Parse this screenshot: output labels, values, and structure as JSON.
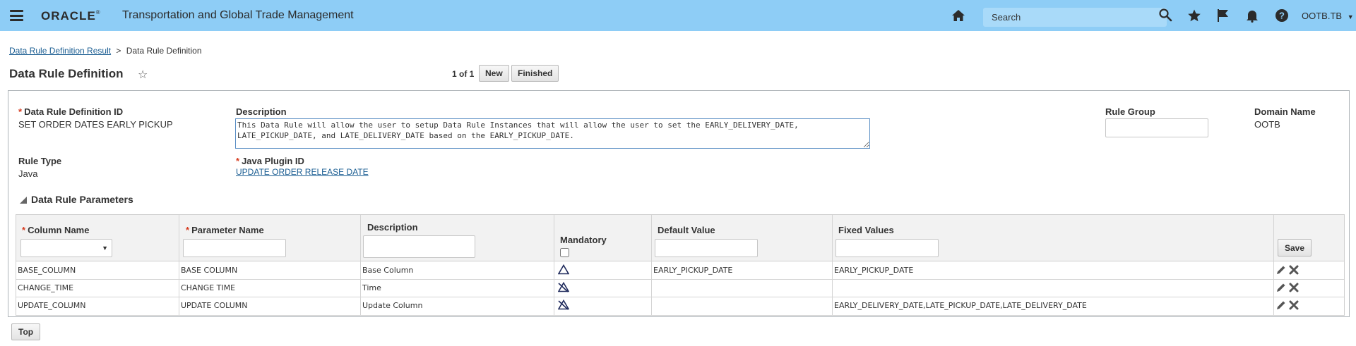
{
  "header": {
    "brand": "ORACLE",
    "app_title": "Transportation and Global Trade Management",
    "search_placeholder": "Search",
    "user": "OOTB.TB"
  },
  "breadcrumb": {
    "parent": "Data Rule Definition Result",
    "separator": ">",
    "current": "Data Rule Definition"
  },
  "page": {
    "title": "Data Rule Definition",
    "pager": "1 of 1",
    "new_label": "New",
    "finished_label": "Finished"
  },
  "form": {
    "id_label": "Data Rule Definition ID",
    "id_value": "SET ORDER DATES EARLY PICKUP",
    "description_label": "Description",
    "description_value": "This Data Rule will allow the user to setup Data Rule Instances that will allow the user to set the EARLY_DELIVERY_DATE, LATE_PICKUP_DATE, and LATE_DELIVERY_DATE based on the EARLY_PICKUP_DATE.",
    "rule_group_label": "Rule Group",
    "rule_group_value": "",
    "domain_label": "Domain Name",
    "domain_value": "OOTB",
    "rule_type_label": "Rule Type",
    "rule_type_value": "Java",
    "plugin_label": "Java Plugin ID",
    "plugin_value": "UPDATE ORDER RELEASE DATE"
  },
  "params": {
    "section_title": "Data Rule Parameters",
    "columns": {
      "column_name": "Column Name",
      "parameter_name": "Parameter Name",
      "description": "Description",
      "mandatory": "Mandatory",
      "default_value": "Default Value",
      "fixed_values": "Fixed Values"
    },
    "save_label": "Save",
    "rows": [
      {
        "column": "BASE_COLUMN",
        "parameter": "BASE COLUMN",
        "description": "Base Column",
        "mandatory": true,
        "default": "EARLY_PICKUP_DATE",
        "fixed": "EARLY_PICKUP_DATE"
      },
      {
        "column": "CHANGE_TIME",
        "parameter": "CHANGE TIME",
        "description": "Time",
        "mandatory": false,
        "default": "",
        "fixed": ""
      },
      {
        "column": "UPDATE_COLUMN",
        "parameter": "UPDATE COLUMN",
        "description": "Update Column",
        "mandatory": false,
        "default": "",
        "fixed": "EARLY_DELIVERY_DATE,LATE_PICKUP_DATE,LATE_DELIVERY_DATE"
      }
    ]
  },
  "footer": {
    "top_label": "Top"
  }
}
